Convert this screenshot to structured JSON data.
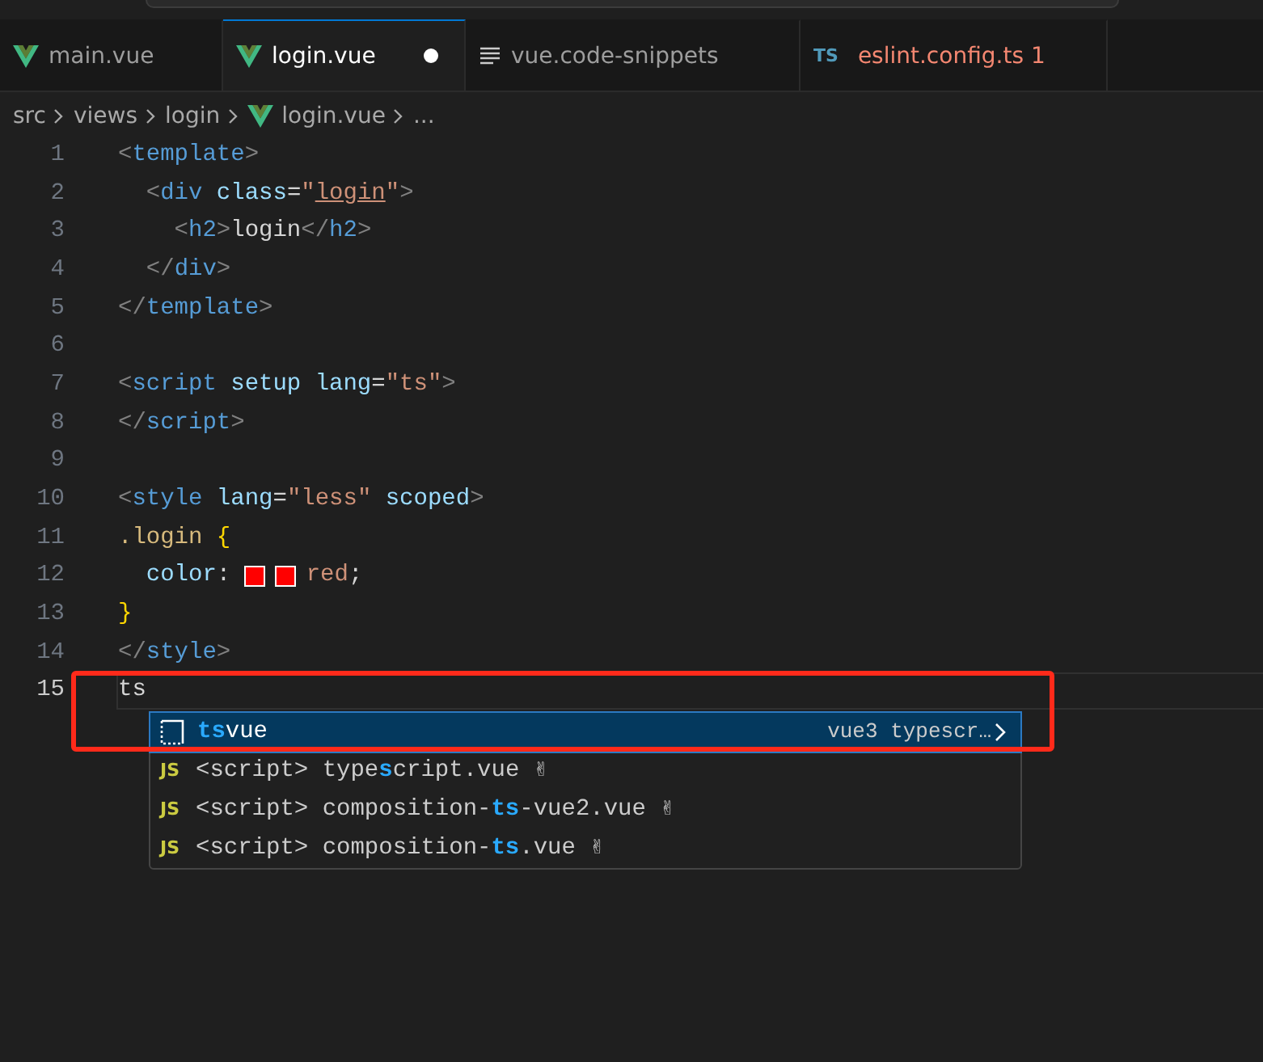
{
  "tabs": [
    {
      "kind": "vue",
      "label": "main.vue",
      "selected": false,
      "modified": false,
      "error": false
    },
    {
      "kind": "vue",
      "label": "login.vue",
      "selected": true,
      "modified": true,
      "error": false
    },
    {
      "kind": "snippet",
      "label": "vue.code-snippets",
      "selected": false,
      "modified": false,
      "error": false
    },
    {
      "kind": "ts",
      "badge": "TS",
      "label": "eslint.config.ts",
      "selected": false,
      "modified": false,
      "error": true,
      "problems": "1"
    }
  ],
  "breadcrumb": [
    {
      "label": "src"
    },
    {
      "label": "views"
    },
    {
      "label": "login"
    },
    {
      "label": "login.vue",
      "kind": "vue"
    },
    {
      "label": "..."
    }
  ],
  "lines": [
    {
      "number": "1",
      "current": false,
      "tokens": [
        {
          "kind": "punct",
          "text": "<"
        },
        {
          "kind": "tag",
          "text": "template"
        },
        {
          "kind": "punct",
          "text": ">"
        }
      ]
    },
    {
      "number": "2",
      "current": false,
      "tokens": [
        {
          "kind": "punct",
          "text": "  <"
        },
        {
          "kind": "tag",
          "text": "div"
        },
        {
          "kind": "attr",
          "text": " class"
        },
        {
          "kind": "text",
          "text": "="
        },
        {
          "kind": "str",
          "text": "\""
        },
        {
          "kind": "str-underlined",
          "text": "login"
        },
        {
          "kind": "str",
          "text": "\""
        },
        {
          "kind": "punct",
          "text": ">"
        }
      ]
    },
    {
      "number": "3",
      "current": false,
      "tokens": [
        {
          "kind": "punct",
          "text": "    <"
        },
        {
          "kind": "tag",
          "text": "h2"
        },
        {
          "kind": "punct",
          "text": ">"
        },
        {
          "kind": "text",
          "text": "login"
        },
        {
          "kind": "punct",
          "text": "</"
        },
        {
          "kind": "tag",
          "text": "h2"
        },
        {
          "kind": "punct",
          "text": ">"
        }
      ]
    },
    {
      "number": "4",
      "current": false,
      "tokens": [
        {
          "kind": "punct",
          "text": "  </"
        },
        {
          "kind": "tag",
          "text": "div"
        },
        {
          "kind": "punct",
          "text": ">"
        }
      ]
    },
    {
      "number": "5",
      "current": false,
      "tokens": [
        {
          "kind": "punct",
          "text": "</"
        },
        {
          "kind": "tag",
          "text": "template"
        },
        {
          "kind": "punct",
          "text": ">"
        }
      ]
    },
    {
      "number": "6",
      "current": false
    },
    {
      "number": "7",
      "current": false,
      "tokens": [
        {
          "kind": "punct",
          "text": "<"
        },
        {
          "kind": "tag",
          "text": "script"
        },
        {
          "kind": "attr",
          "text": " setup lang"
        },
        {
          "kind": "text",
          "text": "="
        },
        {
          "kind": "str",
          "text": "\"ts\""
        },
        {
          "kind": "punct",
          "text": ">"
        }
      ]
    },
    {
      "number": "8",
      "current": false,
      "tokens": [
        {
          "kind": "punct",
          "text": "</"
        },
        {
          "kind": "tag",
          "text": "script"
        },
        {
          "kind": "punct",
          "text": ">"
        }
      ]
    },
    {
      "number": "9",
      "current": false
    },
    {
      "number": "10",
      "current": false,
      "tokens": [
        {
          "kind": "punct",
          "text": "<"
        },
        {
          "kind": "tag",
          "text": "style"
        },
        {
          "kind": "attr",
          "text": " lang"
        },
        {
          "kind": "text",
          "text": "="
        },
        {
          "kind": "str",
          "text": "\"less\""
        },
        {
          "kind": "attr",
          "text": " scoped"
        },
        {
          "kind": "punct",
          "text": ">"
        }
      ]
    },
    {
      "number": "11",
      "current": false,
      "tokens": [
        {
          "kind": "selector",
          "text": ".login "
        },
        {
          "kind": "brace",
          "text": "{"
        }
      ]
    },
    {
      "number": "12",
      "current": false,
      "tokens": [
        {
          "kind": "attr",
          "text": "  color"
        },
        {
          "kind": "text",
          "text": ": "
        },
        {
          "kind": "swatch",
          "color": "#ff0000"
        },
        {
          "kind": "swatch",
          "color": "#ff0000"
        },
        {
          "kind": "str",
          "text": "red"
        },
        {
          "kind": "text",
          "text": ";"
        }
      ]
    },
    {
      "number": "13",
      "current": false,
      "tokens": [
        {
          "kind": "brace",
          "text": "}"
        }
      ]
    },
    {
      "number": "14",
      "current": false,
      "tokens": [
        {
          "kind": "punct",
          "text": "</"
        },
        {
          "kind": "tag",
          "text": "style"
        },
        {
          "kind": "punct",
          "text": ">"
        }
      ]
    },
    {
      "number": "15",
      "current": true,
      "tokens": [
        {
          "kind": "text",
          "text": "ts"
        }
      ]
    }
  ],
  "suggestions": [
    {
      "kind": "snippet",
      "selected": true,
      "parts": [
        {
          "text": "ts",
          "match": true
        },
        {
          "text": "vue",
          "match": false
        }
      ],
      "detail": "vue3 typescr…"
    },
    {
      "kind": "js",
      "badge": "JS",
      "selected": false,
      "parts": [
        {
          "text": "<script> type",
          "match": false
        },
        {
          "text": "s",
          "match": true
        },
        {
          "text": "cript.vue ✌",
          "match": false
        }
      ]
    },
    {
      "kind": "js",
      "badge": "JS",
      "selected": false,
      "parts": [
        {
          "text": "<script> composition-",
          "match": false
        },
        {
          "text": "ts",
          "match": true
        },
        {
          "text": "-vue2.vue ✌",
          "match": false
        }
      ]
    },
    {
      "kind": "js",
      "badge": "JS",
      "selected": false,
      "parts": [
        {
          "text": "<script> composition-",
          "match": false
        },
        {
          "text": "ts",
          "match": true
        },
        {
          "text": ".vue ✌",
          "match": false
        }
      ]
    }
  ]
}
